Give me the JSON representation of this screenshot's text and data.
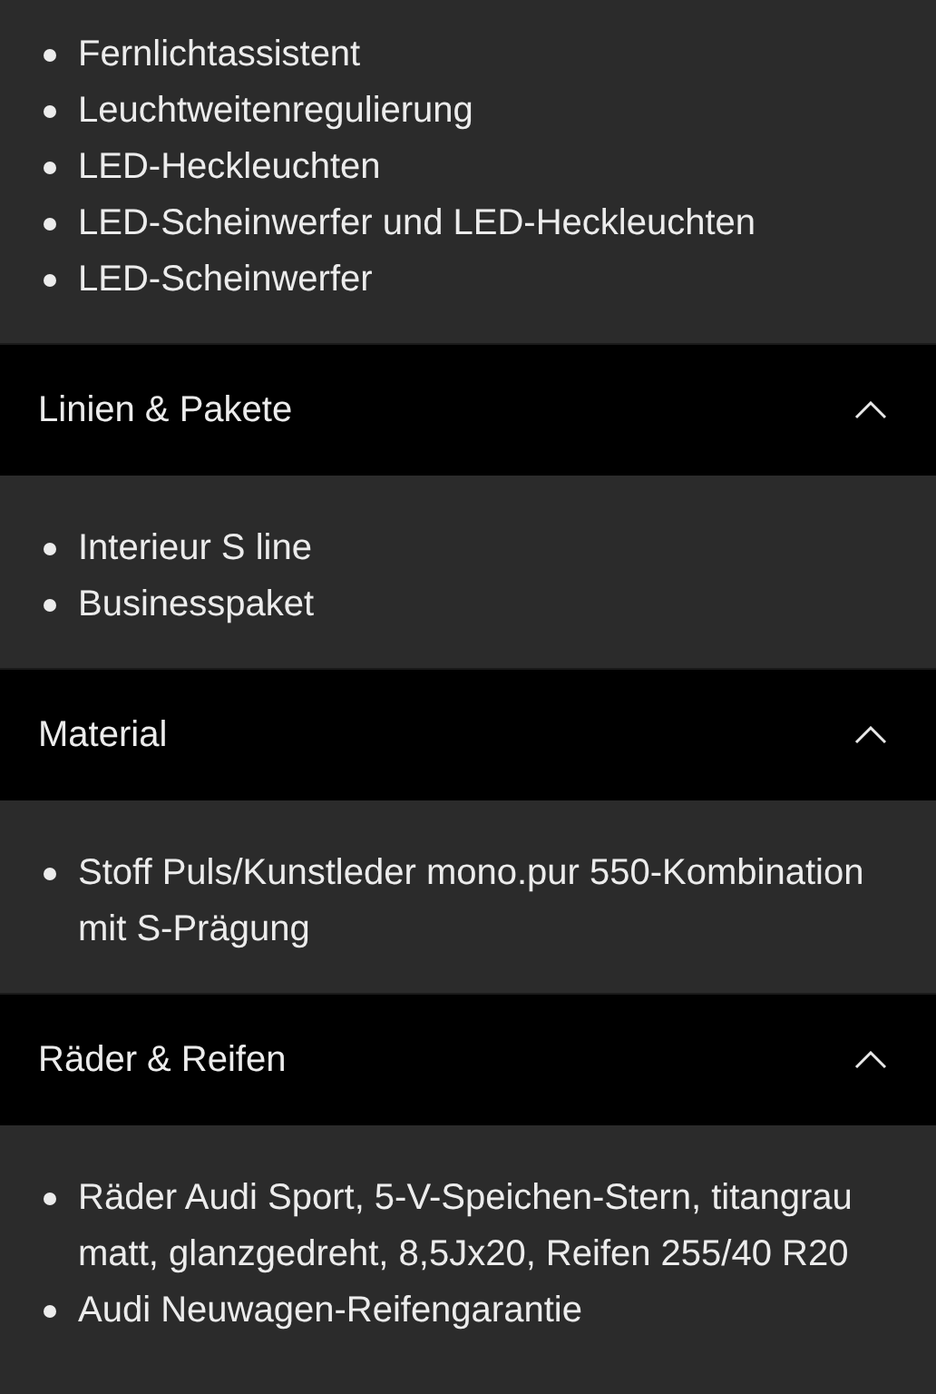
{
  "sections": [
    {
      "items": [
        "Fernlichtassistent",
        "Leuchtweitenregulierung",
        "LED-Heckleuchten",
        "LED-Scheinwerfer und LED-Heckleuchten",
        "LED-Scheinwerfer"
      ]
    },
    {
      "title": "Linien & Pakete",
      "expanded": true,
      "items": [
        "Interieur S line",
        "Businesspaket"
      ]
    },
    {
      "title": "Material",
      "expanded": true,
      "items": [
        "Stoff Puls/Kunstleder mono.pur 550-Kombination mit S-Prägung"
      ]
    },
    {
      "title": "Räder & Reifen",
      "expanded": true,
      "items": [
        "Räder Audi Sport, 5-V-Speichen-Stern, titangrau matt, glanzgedreht, 8,5Jx20, Reifen 255/40 R20",
        "Audi Neuwagen-Reifengarantie"
      ]
    }
  ]
}
